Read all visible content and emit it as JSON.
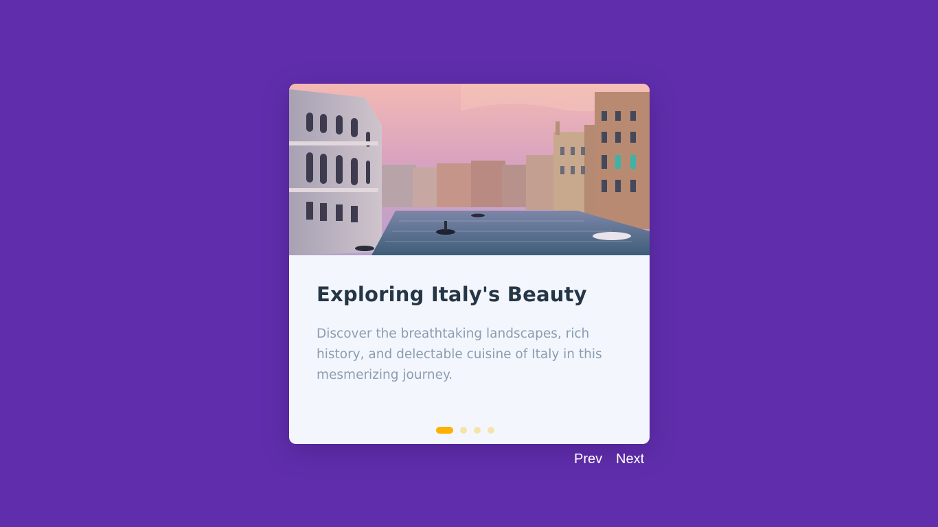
{
  "colors": {
    "page_background": "#602eac",
    "card_background": "#f3f6fc",
    "title_color": "#253646",
    "text_color": "#8a9db2",
    "dot_active": "#ffb000",
    "dot_inactive": "#f6e3aa"
  },
  "slide": {
    "title": "Exploring Italy's Beauty",
    "description": "Discover the breathtaking landscapes, rich history, and delectable cuisine of Italy in this mesmerizing journey.",
    "image_subject": "Venice Grand Canal at sunset with gondolas and historic buildings"
  },
  "pagination": {
    "total": 4,
    "active_index": 0
  },
  "controls": {
    "prev_label": "Prev",
    "next_label": "Next"
  }
}
